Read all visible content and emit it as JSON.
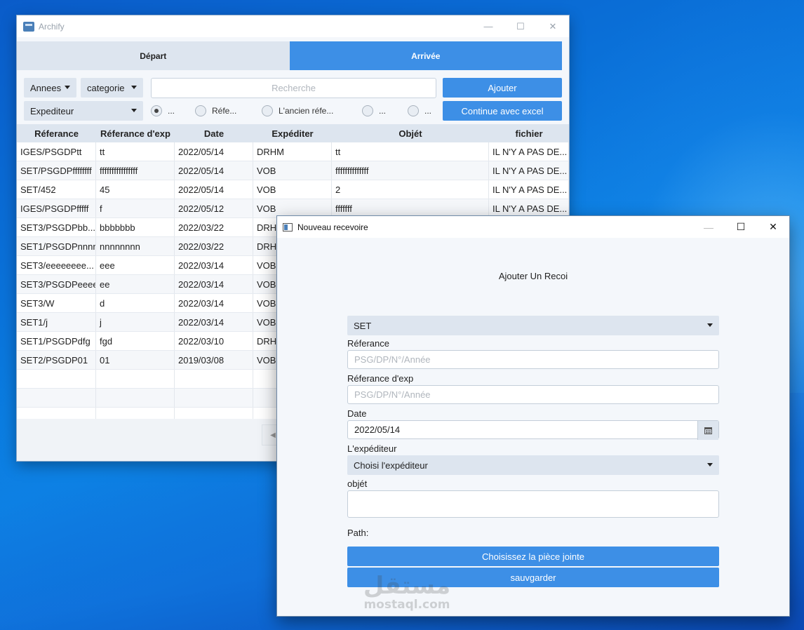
{
  "main_window": {
    "title": "Archify",
    "tabs": [
      {
        "label": "Départ"
      },
      {
        "label": "Arrivée"
      }
    ],
    "filters": {
      "years_label": "Annees",
      "category_label": "categorie",
      "sender_label": "Expediteur",
      "search_placeholder": "Recherche",
      "add_label": "Ajouter",
      "excel_label": "Continue avec excel",
      "radios": [
        {
          "label": "...",
          "selected": true
        },
        {
          "label": "Réfe...",
          "selected": false
        },
        {
          "label": "L'ancien réfe...",
          "selected": false
        },
        {
          "label": "...",
          "selected": false
        },
        {
          "label": "...",
          "selected": false
        }
      ]
    },
    "table": {
      "headers": [
        "Réferance",
        "Réferance d'exp",
        "Date",
        "Expéditer",
        "Objét",
        "fichier"
      ],
      "rows": [
        [
          "IGES/PSGDPtt",
          "tt",
          "2022/05/14",
          "DRHM",
          "tt",
          "IL N'Y A PAS DE..."
        ],
        [
          "SET/PSGDPffffffff",
          "ffffffffffffffff",
          "2022/05/14",
          "VOB",
          "ffffffffffffff",
          "IL N'Y A PAS DE..."
        ],
        [
          "SET/452",
          "45",
          "2022/05/14",
          "VOB",
          "2",
          "IL N'Y A PAS DE..."
        ],
        [
          "IGES/PSGDPfffff",
          "f",
          "2022/05/12",
          "VOB",
          "fffffff",
          "IL N'Y A PAS DE..."
        ],
        [
          "SET3/PSGDPbb...",
          "bbbbbbb",
          "2022/03/22",
          "DRHM",
          "",
          ""
        ],
        [
          "SET1/PSGDPnnnn",
          "nnnnnnnn",
          "2022/03/22",
          "DRHM",
          "",
          ""
        ],
        [
          "SET3/eeeeeeee...",
          "eee",
          "2022/03/14",
          "VOB",
          "",
          ""
        ],
        [
          "SET3/PSGDPeeee",
          "ee",
          "2022/03/14",
          "VOB",
          "",
          ""
        ],
        [
          "SET3/W",
          "d",
          "2022/03/14",
          "VOB",
          "",
          ""
        ],
        [
          "SET1/j",
          "j",
          "2022/03/14",
          "VOB",
          "",
          ""
        ],
        [
          "SET1/PSGDPdfg",
          "fgd",
          "2022/03/10",
          "DRHM",
          "",
          ""
        ],
        [
          "SET2/PSGDP01",
          "01",
          "2019/03/08",
          "VOB",
          "",
          ""
        ],
        [
          "",
          "",
          "",
          "",
          "",
          ""
        ],
        [
          "",
          "",
          "",
          "",
          "",
          ""
        ],
        [
          "",
          "",
          "",
          "",
          "",
          ""
        ]
      ]
    }
  },
  "dialog": {
    "title": "Nouveau recevoire",
    "heading": "Ajouter Un Recoi",
    "category_value": "SET",
    "reference_label": "Réferance",
    "reference_placeholder": "PSG/DP/N°/Année",
    "exp_reference_label": "Réferance d'exp",
    "exp_reference_placeholder": "PSG/DP/N°/Année",
    "date_label": "Date",
    "date_value": "2022/05/14",
    "sender_label": "L'expéditeur",
    "sender_value": "Choisi l'expéditeur",
    "object_label": "objét",
    "path_label": "Path:",
    "attach_label": "Choisissez la pièce jointe",
    "save_label": "sauvgarder"
  },
  "watermark": {
    "arabic": "مستقل",
    "latin": "mostaql.com"
  },
  "colors": {
    "accent": "#3d8fe6",
    "control_bg": "#dde5ef",
    "window_bg": "#f4f7fb",
    "desktop": "#0a74db"
  }
}
